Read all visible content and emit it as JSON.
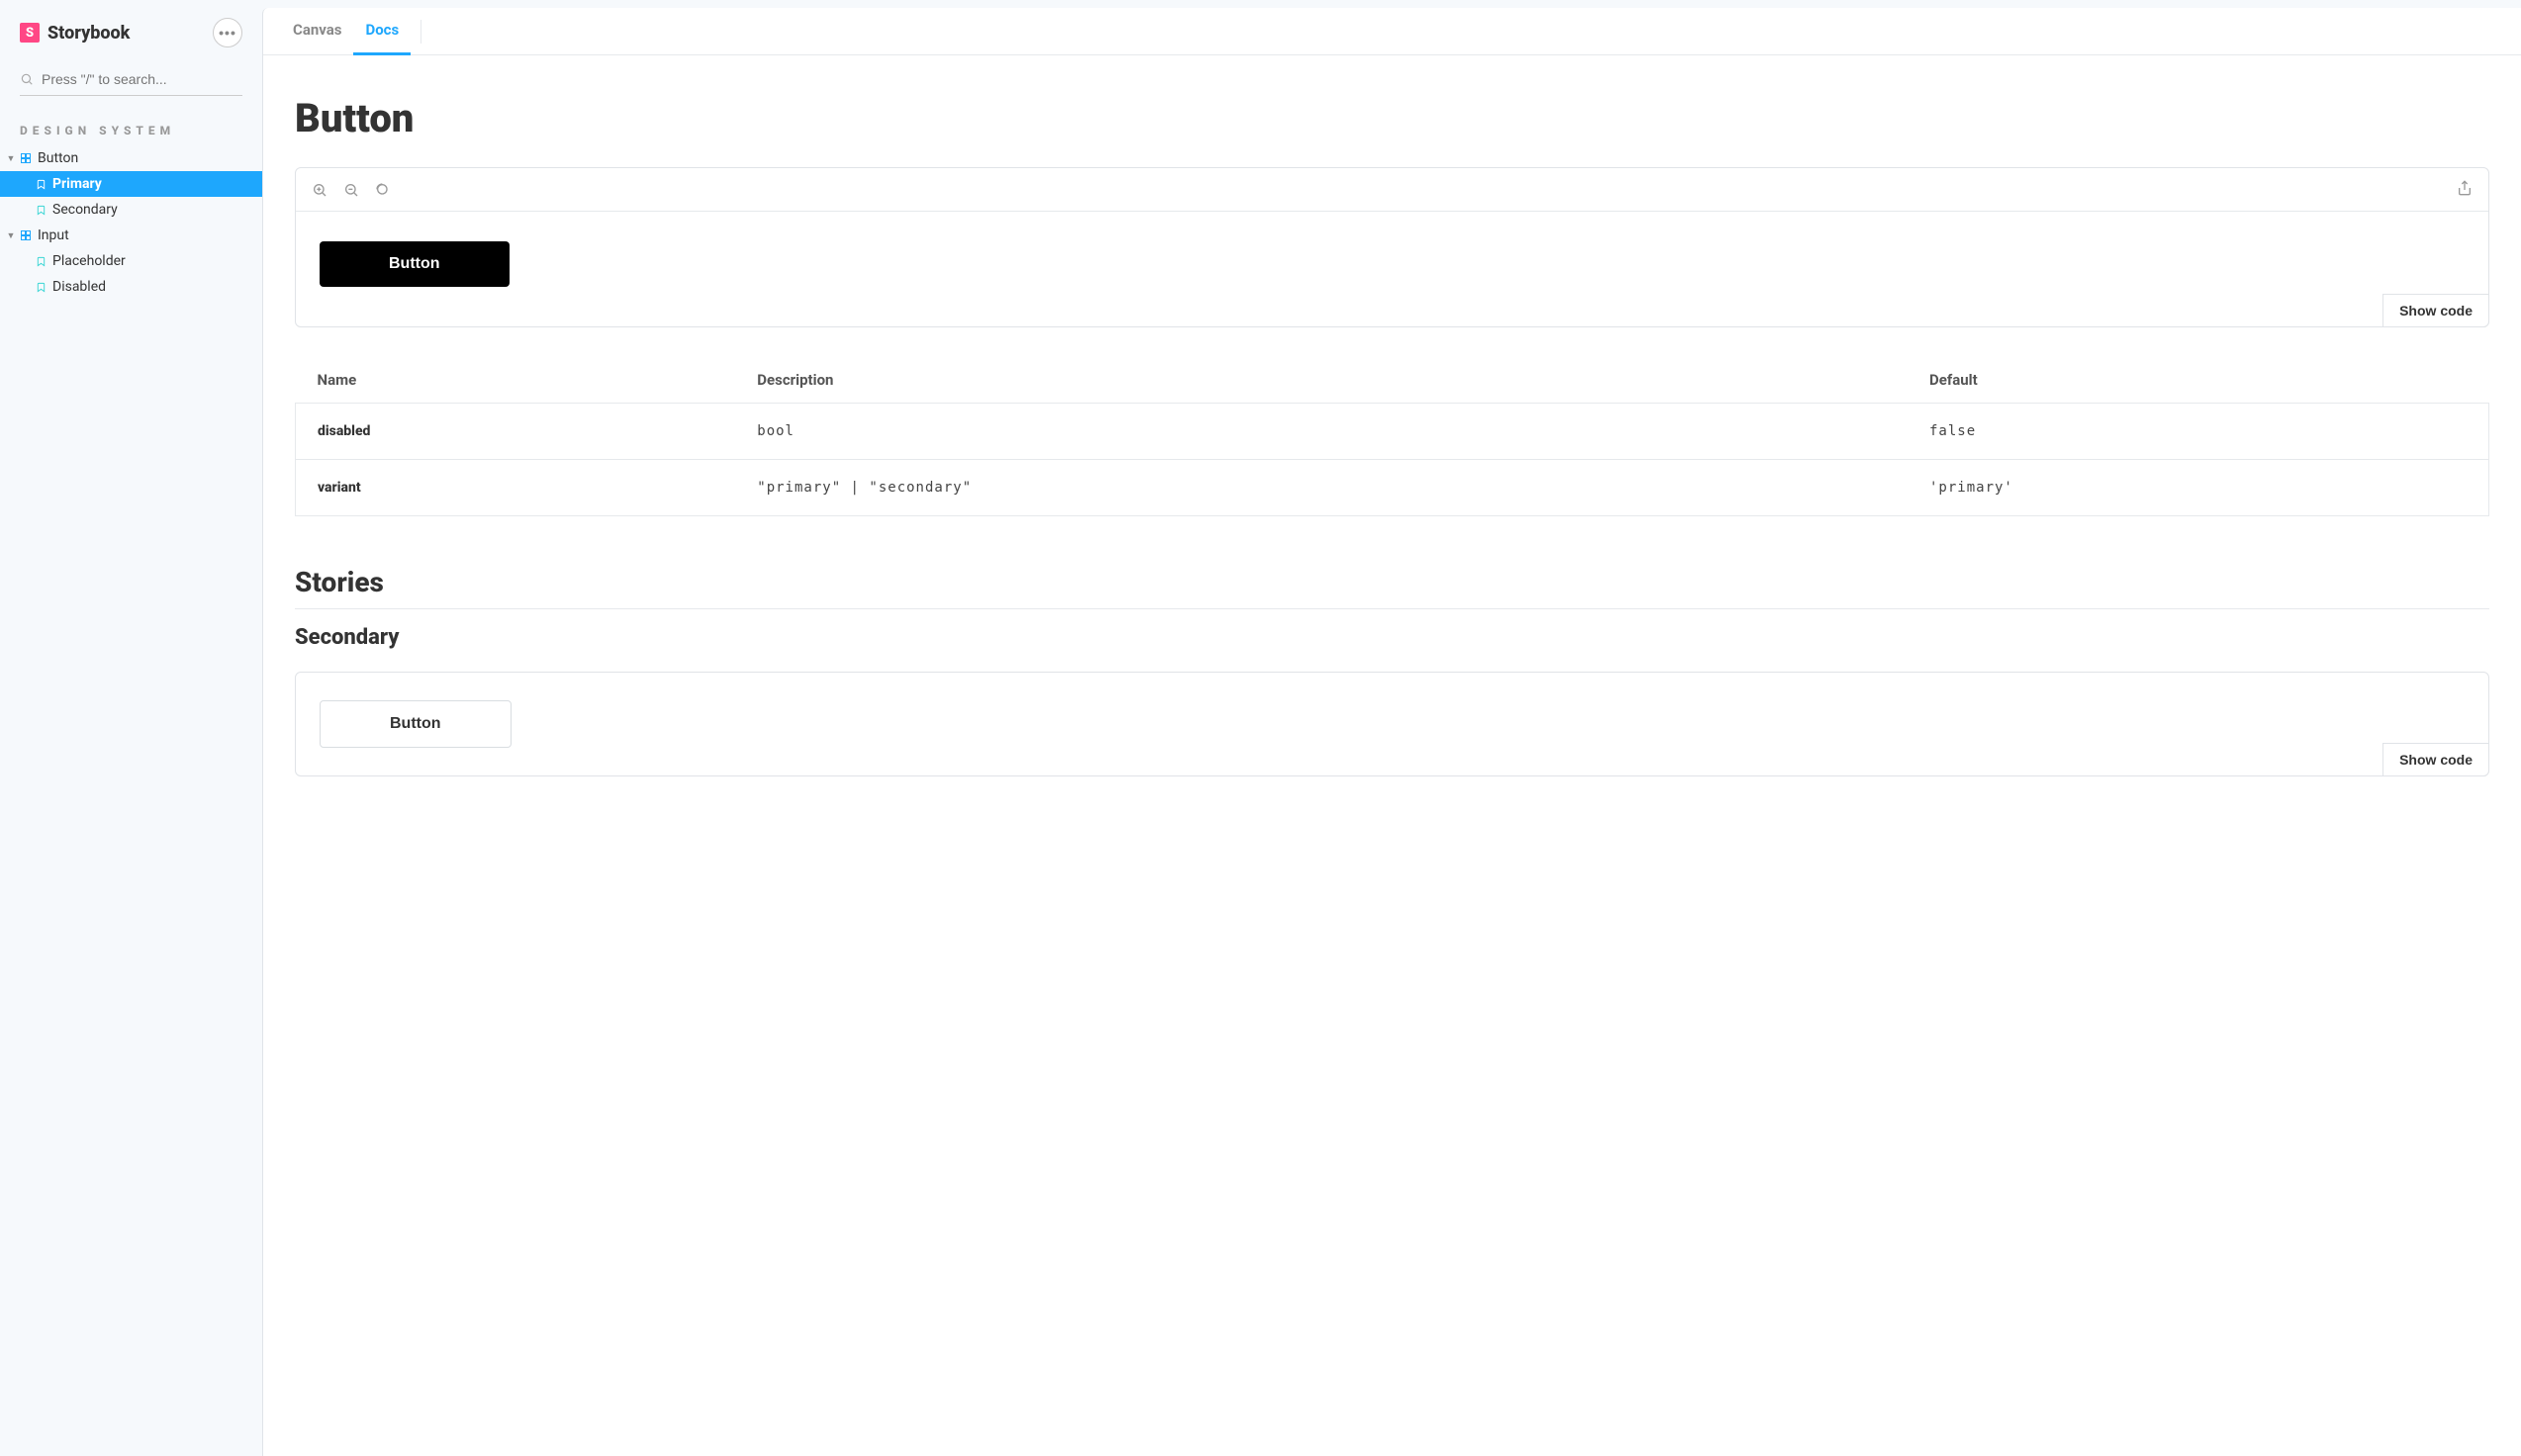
{
  "brand": {
    "title": "Storybook",
    "logo_letter": "S"
  },
  "search": {
    "placeholder": "Press \"/\" to search..."
  },
  "section_heading": "Design System",
  "sidebar": {
    "items": [
      {
        "label": "Button",
        "type": "component"
      },
      {
        "label": "Primary",
        "type": "story"
      },
      {
        "label": "Secondary",
        "type": "story"
      },
      {
        "label": "Input",
        "type": "component"
      },
      {
        "label": "Placeholder",
        "type": "story"
      },
      {
        "label": "Disabled",
        "type": "story"
      }
    ]
  },
  "tabs": {
    "canvas": "Canvas",
    "docs": "Docs"
  },
  "page": {
    "title": "Button",
    "show_code": "Show code",
    "stories_heading": "Stories",
    "secondary_heading": "Secondary"
  },
  "preview": {
    "primary_label": "Button",
    "secondary_label": "Button"
  },
  "props_table": {
    "headers": {
      "name": "Name",
      "description": "Description",
      "default": "Default"
    },
    "rows": [
      {
        "name": "disabled",
        "description": "bool",
        "default": "false"
      },
      {
        "name": "variant",
        "description": "\"primary\" | \"secondary\"",
        "default": "'primary'"
      }
    ]
  }
}
